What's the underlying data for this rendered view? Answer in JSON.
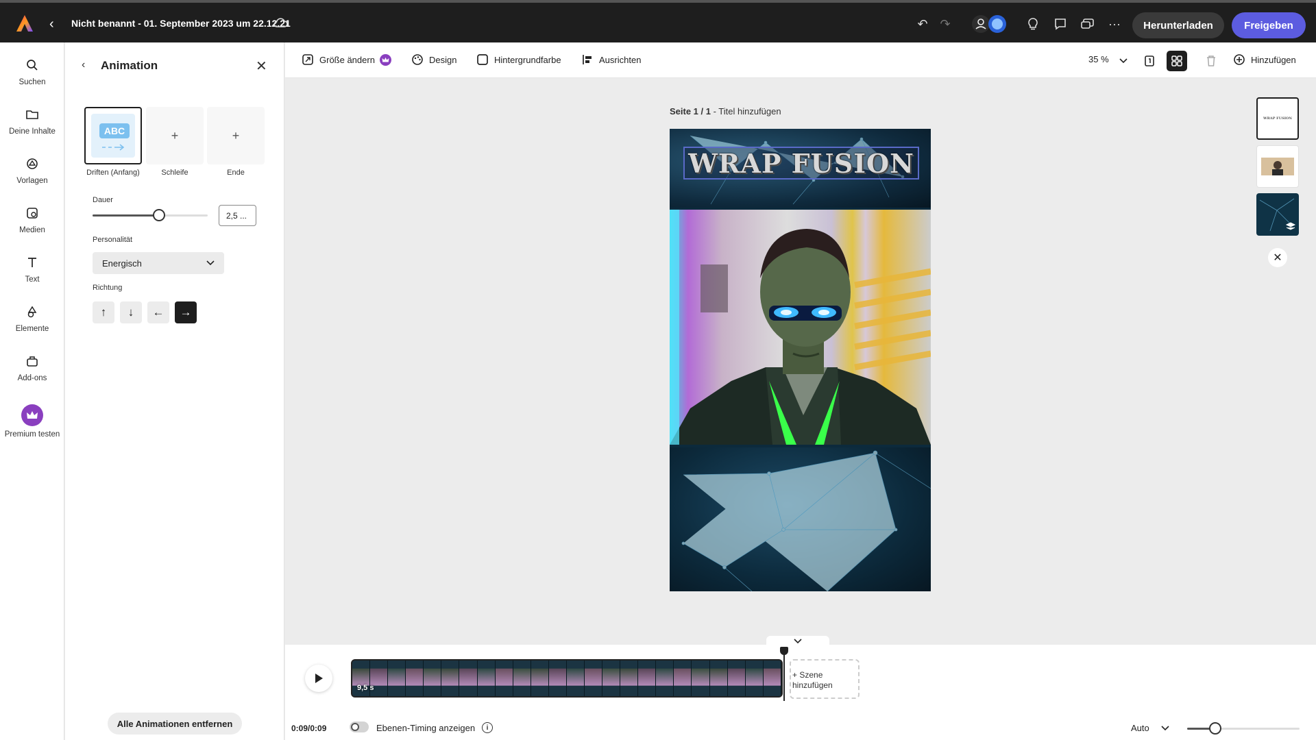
{
  "app": {
    "document_title": "Nicht benannt - 01. September 2023 um 22.12.21",
    "download_label": "Herunterladen",
    "share_label": "Freigeben",
    "brand_color": "#5c5ce0"
  },
  "rail": {
    "items": [
      {
        "label": "Suchen",
        "icon": "search-icon"
      },
      {
        "label": "Deine Inhalte",
        "icon": "folder-icon"
      },
      {
        "label": "Vorlagen",
        "icon": "templates-icon"
      },
      {
        "label": "Medien",
        "icon": "media-icon"
      },
      {
        "label": "Text",
        "icon": "text-icon"
      },
      {
        "label": "Elemente",
        "icon": "elements-icon"
      },
      {
        "label": "Add-ons",
        "icon": "addons-icon"
      },
      {
        "label": "Premium testen",
        "icon": "crown-icon"
      }
    ]
  },
  "panel": {
    "title": "Animation",
    "slots": [
      {
        "label": "Driften (Anfang)",
        "preview_text": "ABC"
      },
      {
        "label": "Schleife",
        "symbol": "+"
      },
      {
        "label": "Ende",
        "symbol": "+"
      }
    ],
    "duration": {
      "label": "Dauer",
      "value": "2,5 ...",
      "slider_fraction": 0.58
    },
    "personality": {
      "label": "Personalität",
      "selected": "Energisch"
    },
    "direction": {
      "label": "Richtung",
      "buttons": [
        "↑",
        "↓",
        "←",
        "→"
      ],
      "active_index": 3
    },
    "remove_all_label": "Alle Animationen entfernen"
  },
  "toolbar": {
    "resize_label": "Größe ändern",
    "design_label": "Design",
    "background_label": "Hintergrundfarbe",
    "align_label": "Ausrichten",
    "zoom": "35 %",
    "add_label": "Hinzufügen"
  },
  "canvas": {
    "page_index": "Seite 1 / 1",
    "page_title_hint": " - Titel hinzufügen",
    "artwork_title": "WRAP FUSION"
  },
  "thumbnails": {
    "first_text": "WRAP FUSION"
  },
  "timeline": {
    "scene_duration": "9,5 s",
    "add_scene_label_line1": "+ Szene",
    "add_scene_label_line2": "hinzufügen",
    "time": "0:09/0:09",
    "layer_timing_label": "Ebenen-Timing anzeigen",
    "zoom_mode": "Auto",
    "zoom_fraction": 0.25
  }
}
